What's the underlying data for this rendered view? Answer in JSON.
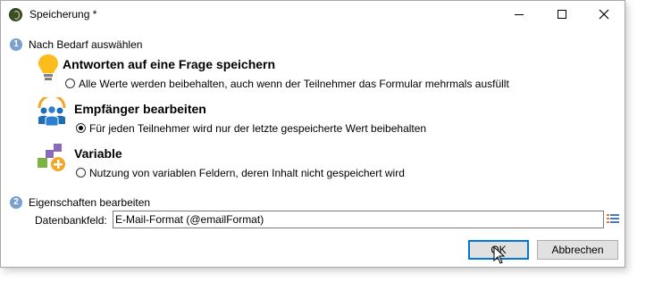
{
  "window": {
    "title": "Speicherung *"
  },
  "step1": {
    "number": "1",
    "label": "Nach Bedarf auswählen"
  },
  "options": [
    {
      "title": "Antworten auf eine Frage speichern",
      "description": "Alle Werte werden beibehalten, auch wenn der Teilnehmer das Formular mehrmals ausfüllt",
      "checked": false,
      "icon": "lightbulb-icon"
    },
    {
      "title": "Empfänger bearbeiten",
      "description": "Für jeden Teilnehmer wird nur der letzte gespeicherte Wert beibehalten",
      "checked": true,
      "icon": "recipients-icon"
    },
    {
      "title": "Variable",
      "description": "Nutzung von variablen Feldern, deren Inhalt nicht gespeichert wird",
      "checked": false,
      "icon": "variable-add-icon"
    }
  ],
  "step2": {
    "number": "2",
    "label": "Eigenschaften bearbeiten"
  },
  "field": {
    "label": "Datenbankfeld:",
    "value": "E-Mail-Format (@emailFormat)"
  },
  "buttons": {
    "ok": "OK",
    "cancel": "Abbrechen"
  },
  "colors": {
    "accent": "#0078d7",
    "step_badge": "#7b9fce",
    "button_bg": "#e1e1e1"
  }
}
